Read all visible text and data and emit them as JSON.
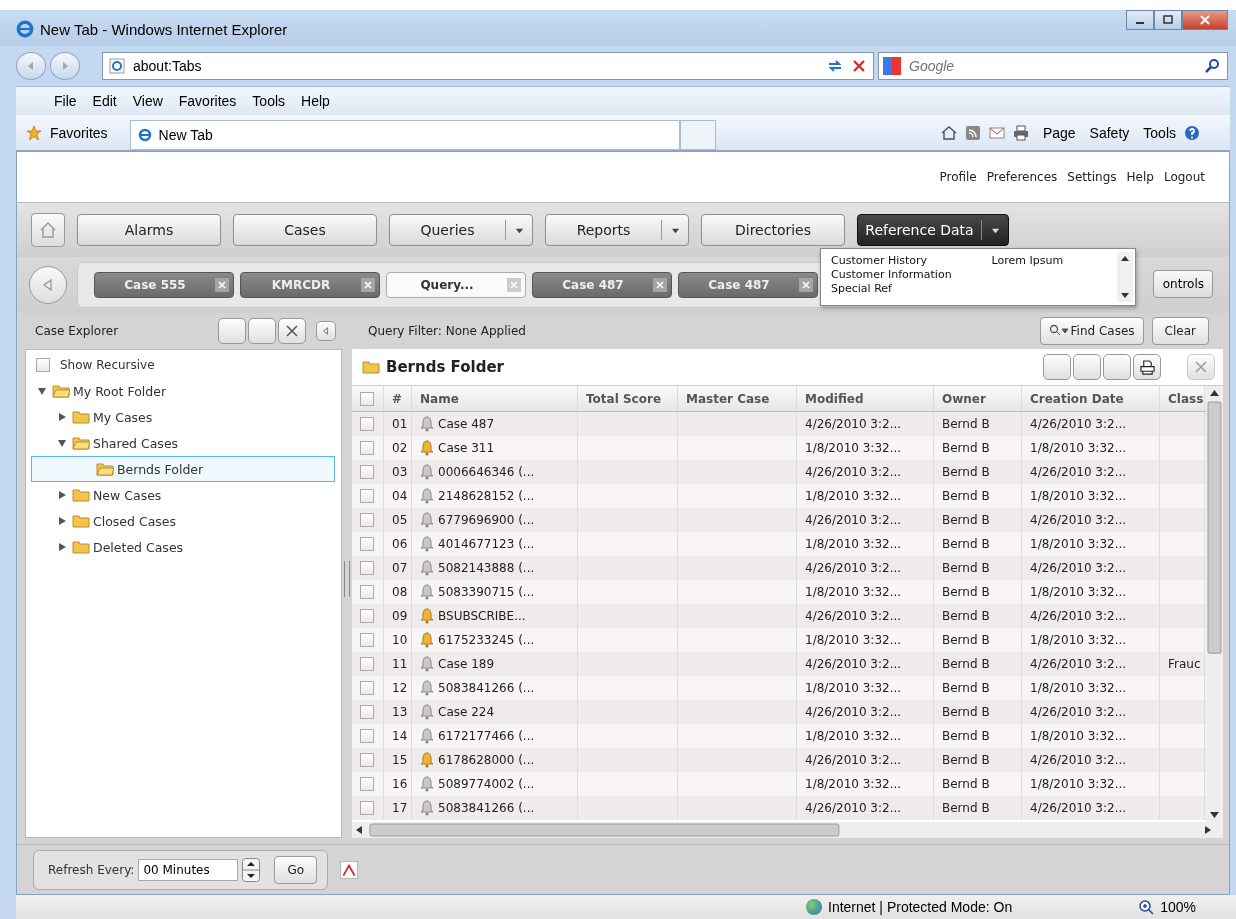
{
  "window": {
    "title": "New Tab - Windows Internet Explorer"
  },
  "browser": {
    "address": "about:Tabs",
    "search_placeholder": "Google",
    "menu": [
      "File",
      "Edit",
      "View",
      "Favorites",
      "Tools",
      "Help"
    ],
    "favorites": "Favorites",
    "tab": "New Tab",
    "commands": [
      "Page",
      "Safety",
      "Tools"
    ]
  },
  "header_links": [
    "Profile",
    "Preferences",
    "Settings",
    "Help",
    "Logout"
  ],
  "nav": [
    {
      "label": "Alarms",
      "split": false,
      "selected": false
    },
    {
      "label": "Cases",
      "split": false,
      "selected": false
    },
    {
      "label": "Queries",
      "split": true,
      "selected": false
    },
    {
      "label": "Reports",
      "split": true,
      "selected": false
    },
    {
      "label": "Directories",
      "split": false,
      "selected": false
    },
    {
      "label": "Reference Data",
      "split": true,
      "selected": true
    }
  ],
  "dropdown": {
    "column_1": [
      "Customer History",
      "Customer Information",
      "Special Ref"
    ],
    "column_2": [
      "Lorem Ipsum"
    ]
  },
  "doc_tabs": [
    {
      "label": "Case 555",
      "selected": false
    },
    {
      "label": "KMRCDR",
      "selected": false
    },
    {
      "label": "Query...",
      "selected": true
    },
    {
      "label": "Case 487",
      "selected": false
    },
    {
      "label": "Case 487",
      "selected": false
    }
  ],
  "controls_button": "ontrols",
  "explorer": {
    "title": "Case Explorer",
    "show_recursive": {
      "label": "Show Recursive",
      "checked": false
    },
    "tree": [
      {
        "label": "My Root Folder",
        "expanded": true,
        "selected": false,
        "children": [
          {
            "label": "My Cases",
            "expanded": false,
            "selected": false
          },
          {
            "label": "Shared Cases",
            "expanded": true,
            "selected": false,
            "children": [
              {
                "label": "Bernds Folder",
                "selected": true
              }
            ]
          },
          {
            "label": "New Cases",
            "expanded": false,
            "selected": false
          },
          {
            "label": "Closed Cases",
            "expanded": false,
            "selected": false
          },
          {
            "label": "Deleted Cases",
            "expanded": false,
            "selected": false
          }
        ]
      }
    ]
  },
  "query": {
    "filter": "Query Filter: None Applied",
    "find": "Find Cases",
    "clear": "Clear"
  },
  "folder": {
    "title": "Bernds Folder"
  },
  "table": {
    "all_checked": false,
    "columns": [
      "#",
      "Name",
      "Total Score",
      "Master Case",
      "Modified",
      "Owner",
      "Creation Date",
      "Class"
    ],
    "rows": [
      {
        "n": "01",
        "alarm": false,
        "name": "Case 487",
        "modified": "4/26/2010 3:2...",
        "owner": "Bernd B",
        "created": "4/26/2010 3:2...",
        "checked": false
      },
      {
        "n": "02",
        "alarm": true,
        "name": "Case 311",
        "modified": "1/8/2010 3:32...",
        "owner": "Bernd B",
        "created": "1/8/2010 3:32...",
        "checked": false
      },
      {
        "n": "03",
        "alarm": false,
        "name": "0006646346 (...",
        "modified": "4/26/2010 3:2...",
        "owner": "Bernd B",
        "created": "4/26/2010 3:2...",
        "checked": false
      },
      {
        "n": "04",
        "alarm": false,
        "name": "2148628152 (...",
        "modified": "1/8/2010 3:32...",
        "owner": "Bernd B",
        "created": "1/8/2010 3:32...",
        "checked": false
      },
      {
        "n": "05",
        "alarm": false,
        "name": "6779696900 (...",
        "modified": "4/26/2010 3:2...",
        "owner": "Bernd B",
        "created": "4/26/2010 3:2...",
        "checked": false
      },
      {
        "n": "06",
        "alarm": false,
        "name": "4014677123 (...",
        "modified": "1/8/2010 3:32...",
        "owner": "Bernd B",
        "created": "1/8/2010 3:32...",
        "checked": false
      },
      {
        "n": "07",
        "alarm": false,
        "name": "5082143888 (...",
        "modified": "4/26/2010 3:2...",
        "owner": "Bernd B",
        "created": "4/26/2010 3:2...",
        "checked": false
      },
      {
        "n": "08",
        "alarm": false,
        "name": "5083390715 (...",
        "modified": "1/8/2010 3:32...",
        "owner": "Bernd B",
        "created": "1/8/2010 3:32...",
        "checked": false
      },
      {
        "n": "09",
        "alarm": true,
        "name": "BSUBSCRIBE...",
        "modified": "4/26/2010 3:2...",
        "owner": "Bernd B",
        "created": "4/26/2010 3:2...",
        "checked": false
      },
      {
        "n": "10",
        "alarm": true,
        "name": "6175233245 (...",
        "modified": "1/8/2010 3:32...",
        "owner": "Bernd B",
        "created": "1/8/2010 3:32...",
        "checked": false
      },
      {
        "n": "11",
        "alarm": false,
        "name": "Case 189",
        "modified": "4/26/2010 3:2...",
        "owner": "Bernd B",
        "created": "4/26/2010 3:2...",
        "class": "Frauc",
        "checked": false
      },
      {
        "n": "12",
        "alarm": false,
        "name": "5083841266 (...",
        "modified": "1/8/2010 3:32...",
        "owner": "Bernd B",
        "created": "1/8/2010 3:32...",
        "checked": false
      },
      {
        "n": "13",
        "alarm": false,
        "name": "Case 224",
        "modified": "4/26/2010 3:2...",
        "owner": "Bernd B",
        "created": "4/26/2010 3:2...",
        "checked": false
      },
      {
        "n": "14",
        "alarm": false,
        "name": "6172177466 (...",
        "modified": "1/8/2010 3:32...",
        "owner": "Bernd B",
        "created": "1/8/2010 3:32...",
        "checked": false
      },
      {
        "n": "15",
        "alarm": true,
        "name": "6178628000 (...",
        "modified": "4/26/2010 3:2...",
        "owner": "Bernd B",
        "created": "4/26/2010 3:2...",
        "checked": false
      },
      {
        "n": "16",
        "alarm": false,
        "name": "5089774002 (...",
        "modified": "1/8/2010 3:32...",
        "owner": "Bernd B",
        "created": "1/8/2010 3:32...",
        "checked": false
      },
      {
        "n": "17",
        "alarm": false,
        "name": "5083841266 (...",
        "modified": "4/26/2010 3:2...",
        "owner": "Bernd B",
        "created": "4/26/2010 3:2...",
        "checked": false
      }
    ]
  },
  "refresh": {
    "label": "Refresh Every:",
    "value": "00 Minutes",
    "go": "Go"
  },
  "status_bar": {
    "zone": "Internet | Protected Mode: On",
    "zoom": "100%"
  }
}
